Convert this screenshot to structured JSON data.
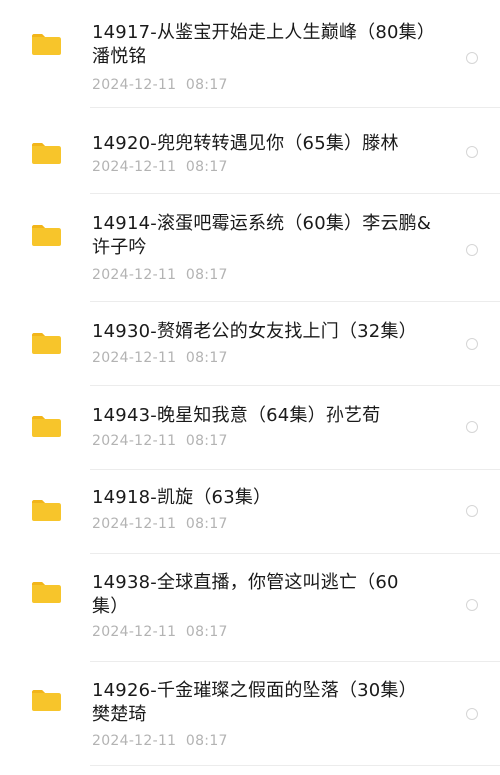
{
  "files": [
    {
      "title_line1": "14917-从鉴宝开始走上人生巅峰（80集）",
      "title_line2": "潘悦铭",
      "date": "2024-12-11",
      "time": "08:17"
    },
    {
      "title_line1": "14920-兜兜转转遇见你（65集）滕林",
      "title_line2": "",
      "date": "2024-12-11",
      "time": "08:17"
    },
    {
      "title_line1": "14914-滚蛋吧霉运系统（60集）李云鹏&",
      "title_line2": "许子吟",
      "date": "2024-12-11",
      "time": "08:17"
    },
    {
      "title_line1": "14930-赘婿老公的女友找上门（32集）",
      "title_line2": "",
      "date": "2024-12-11",
      "time": "08:17"
    },
    {
      "title_line1": "14943-晚星知我意（64集）孙艺荀",
      "title_line2": "",
      "date": "2024-12-11",
      "time": "08:17"
    },
    {
      "title_line1": "14918-凯旋（63集）",
      "title_line2": "",
      "date": "2024-12-11",
      "time": "08:17"
    },
    {
      "title_line1": "14938-全球直播，你管这叫逃亡（60",
      "title_line2": "集）",
      "date": "2024-12-11",
      "time": "08:17"
    },
    {
      "title_line1": "14926-千金璀璨之假面的坠落（30集）",
      "title_line2": "樊楚琦",
      "date": "2024-12-11",
      "time": "08:17"
    }
  ],
  "icons": {
    "folder": "folder-icon",
    "select": "radio-unchecked-icon"
  },
  "colors": {
    "folder": "#f7c52b",
    "folder_tab": "#f2b51a",
    "title": "#1a1a1a",
    "meta": "#b3b3b3"
  }
}
